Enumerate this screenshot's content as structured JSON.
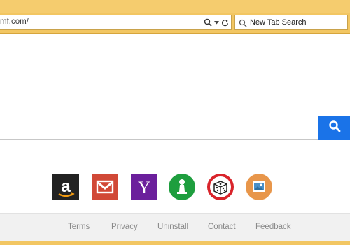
{
  "browser": {
    "address_text": "mf.com/",
    "search_box_text": "New Tab Search"
  },
  "shortcuts": [
    {
      "name": "amazon",
      "label": "a",
      "color": "#222222"
    },
    {
      "name": "gmail",
      "label": "M",
      "color": "#d14836"
    },
    {
      "name": "yahoo",
      "label": "Y",
      "color": "#6b1f9c"
    },
    {
      "name": "chess-game",
      "label": "",
      "color": "#1e9e3e"
    },
    {
      "name": "dice-game",
      "label": "",
      "color": "#d9242b"
    },
    {
      "name": "photos",
      "label": "",
      "color": "#e8964a"
    }
  ],
  "footer": {
    "links": [
      "Terms",
      "Privacy",
      "Uninstall",
      "Contact",
      "Feedback"
    ]
  },
  "colors": {
    "browser_frame": "#f2c662",
    "search_button": "#1a73e8"
  }
}
